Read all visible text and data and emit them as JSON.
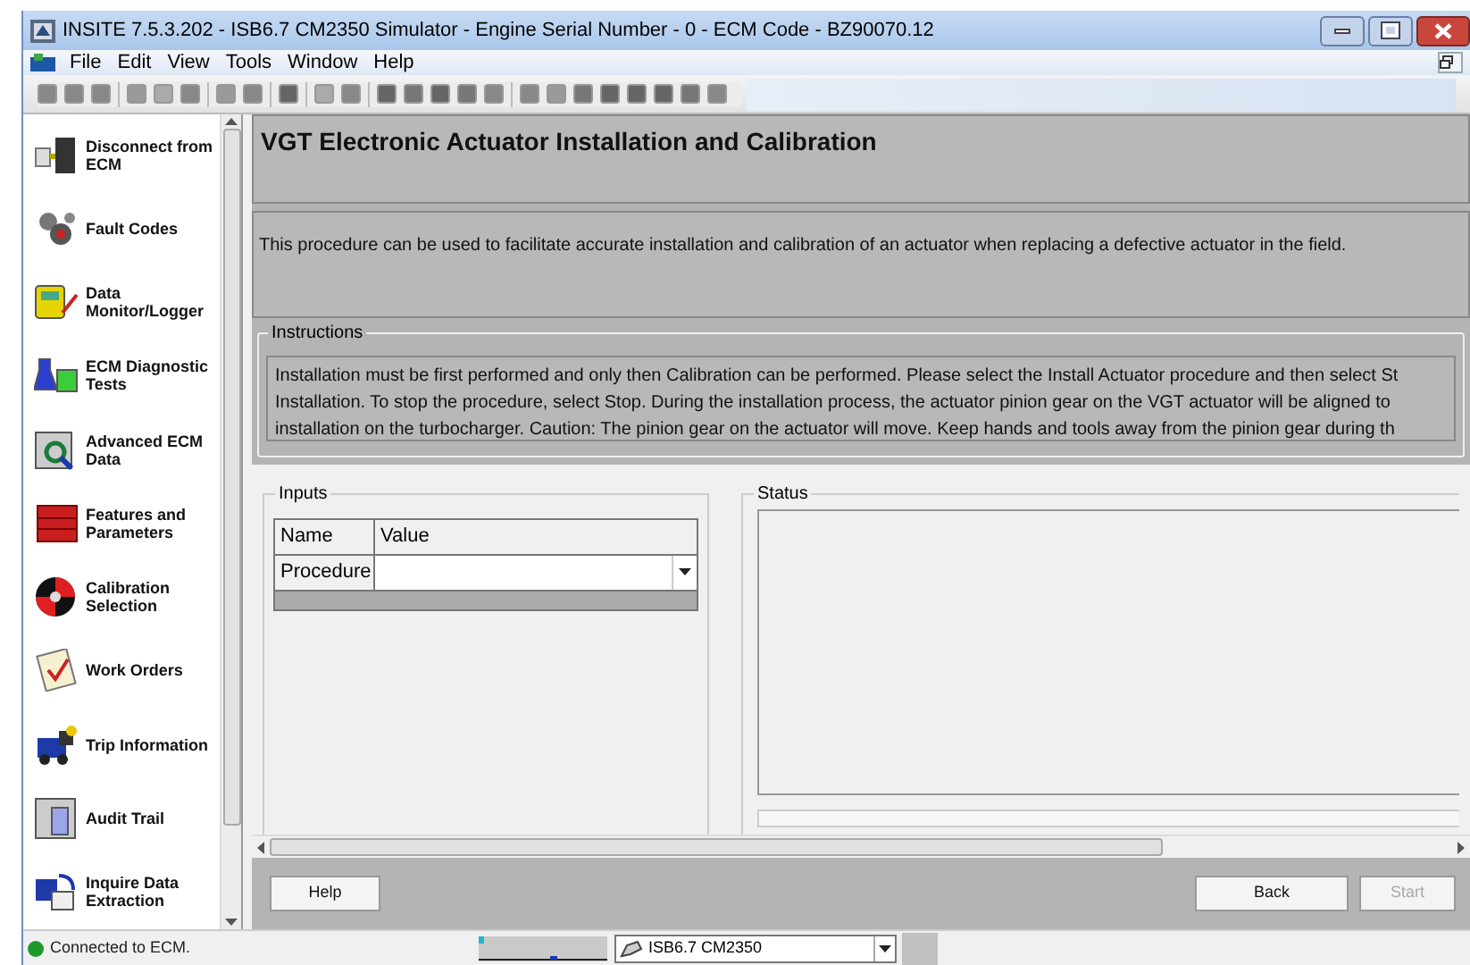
{
  "window": {
    "title": "INSITE 7.5.3.202  - ISB6.7 CM2350 Simulator - Engine Serial Number - 0 - ECM Code - BZ90070.12"
  },
  "menu": [
    "File",
    "Edit",
    "View",
    "Tools",
    "Window",
    "Help"
  ],
  "sidebar": {
    "items": [
      {
        "label": "Disconnect from ECM"
      },
      {
        "label": "Fault Codes"
      },
      {
        "label": "Data Monitor/Logger"
      },
      {
        "label": "ECM Diagnostic Tests"
      },
      {
        "label": "Advanced ECM Data"
      },
      {
        "label": "Features and Parameters"
      },
      {
        "label": "Calibration Selection"
      },
      {
        "label": "Work Orders"
      },
      {
        "label": "Trip Information"
      },
      {
        "label": "Audit Trail"
      },
      {
        "label": "Inquire Data Extraction"
      }
    ]
  },
  "page": {
    "title": "VGT Electronic Actuator Installation and Calibration",
    "description": "This procedure can be used to facilitate accurate installation and calibration of an actuator when replacing a defective actuator in the field.",
    "instructions": {
      "legend": "Instructions",
      "lines": [
        "Installation must be first performed and only then Calibration can be performed. Please select the Install Actuator procedure and then select St",
        "Installation. To stop the procedure, select Stop. During the installation process, the actuator pinion gear on the VGT actuator will be aligned to",
        "installation on the turbocharger. Caution: The pinion gear on the actuator will move. Keep hands and tools away from the pinion gear during th"
      ]
    },
    "inputs": {
      "legend": "Inputs",
      "columns": [
        "Name",
        "Value"
      ],
      "rows": [
        {
          "name": "Procedure"
        }
      ]
    },
    "status": {
      "legend": "Status"
    }
  },
  "buttons": [
    {
      "label": "Help",
      "disabled": false
    },
    {
      "label": "Back",
      "disabled": false
    },
    {
      "label": "Start",
      "disabled": true
    }
  ],
  "status_bar": {
    "connection": "Connected to ECM.",
    "device": "ISB6.7 CM2350"
  }
}
